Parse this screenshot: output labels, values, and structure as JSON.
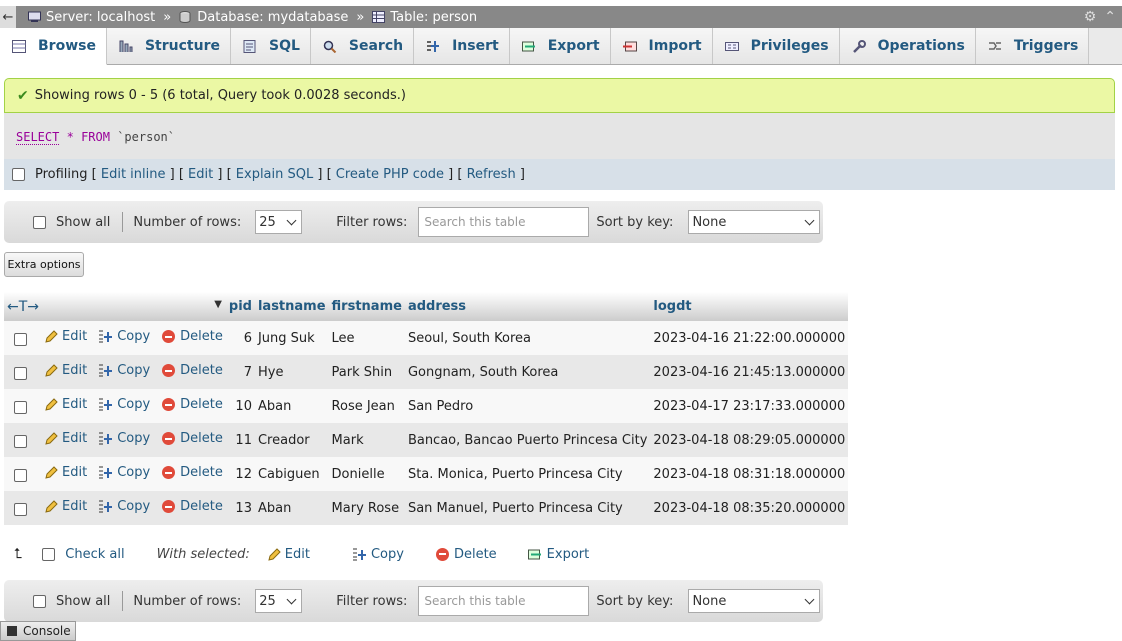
{
  "breadcrumb": {
    "server": "Server: localhost",
    "database": "Database: mydatabase",
    "table": "Table: person",
    "separator": "»"
  },
  "tabs": [
    {
      "label": "Browse",
      "icon": "browse-icon"
    },
    {
      "label": "Structure",
      "icon": "structure-icon"
    },
    {
      "label": "SQL",
      "icon": "sql-icon"
    },
    {
      "label": "Search",
      "icon": "search-icon"
    },
    {
      "label": "Insert",
      "icon": "insert-icon"
    },
    {
      "label": "Export",
      "icon": "export-icon"
    },
    {
      "label": "Import",
      "icon": "import-icon"
    },
    {
      "label": "Privileges",
      "icon": "privileges-icon"
    },
    {
      "label": "Operations",
      "icon": "operations-icon"
    },
    {
      "label": "Triggers",
      "icon": "triggers-icon"
    }
  ],
  "result": {
    "message": "Showing rows 0 - 5 (6 total, Query took 0.0028 seconds.)",
    "sql": {
      "select": "SELECT",
      "star": "*",
      "from": "FROM",
      "table": "`person`"
    }
  },
  "profiling": {
    "label": "Profiling",
    "edit_inline": "Edit inline",
    "edit": "Edit",
    "explain": "Explain SQL",
    "php": "Create PHP code",
    "refresh": "Refresh"
  },
  "nav": {
    "show_all": "Show all",
    "rows_label": "Number of rows:",
    "rows_value": "25",
    "filter_label": "Filter rows:",
    "filter_placeholder": "Search this table",
    "sort_label": "Sort by key:",
    "sort_value": "None"
  },
  "extra_options": "Extra options",
  "table": {
    "columns": [
      "pid",
      "lastname",
      "firstname",
      "address",
      "logdt"
    ],
    "actions": {
      "edit": "Edit",
      "copy": "Copy",
      "delete": "Delete"
    },
    "rows": [
      {
        "pid": "6",
        "lastname": "Jung Suk",
        "firstname": "Lee",
        "address": "Seoul, South Korea",
        "logdt": "2023-04-16 21:22:00.000000"
      },
      {
        "pid": "7",
        "lastname": "Hye",
        "firstname": "Park Shin",
        "address": "Gongnam, South Korea",
        "logdt": "2023-04-16 21:45:13.000000"
      },
      {
        "pid": "10",
        "lastname": "Aban",
        "firstname": "Rose Jean",
        "address": "San Pedro",
        "logdt": "2023-04-17 23:17:33.000000"
      },
      {
        "pid": "11",
        "lastname": "Creador",
        "firstname": "Mark",
        "address": "Bancao, Bancao Puerto Princesa City",
        "logdt": "2023-04-18 08:29:05.000000"
      },
      {
        "pid": "12",
        "lastname": "Cabiguen",
        "firstname": "Donielle",
        "address": "Sta. Monica, Puerto Princesa City",
        "logdt": "2023-04-18 08:31:18.000000"
      },
      {
        "pid": "13",
        "lastname": "Aban",
        "firstname": "Mary Rose",
        "address": "San Manuel, Puerto Princesa City",
        "logdt": "2023-04-18 08:35:20.000000"
      }
    ]
  },
  "bulk": {
    "check_all": "Check all",
    "with_selected": "With selected:",
    "edit": "Edit",
    "copy": "Copy",
    "delete": "Delete",
    "export": "Export"
  },
  "console": "Console"
}
